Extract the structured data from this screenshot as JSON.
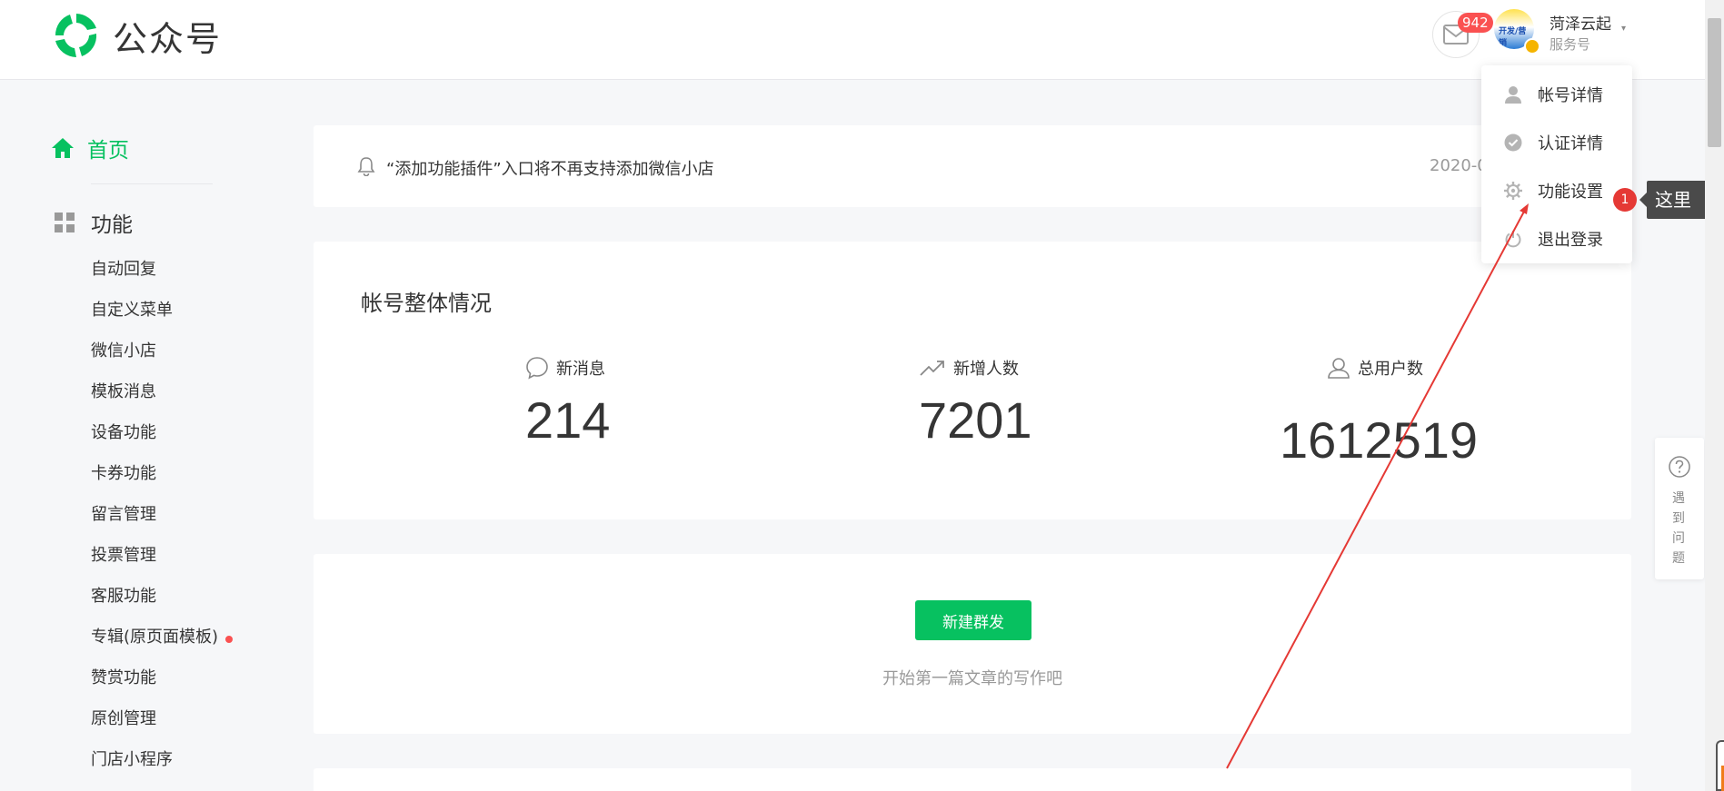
{
  "header": {
    "logo_text": "公众号",
    "message_count": "942",
    "account_name": "菏泽云起",
    "account_type": "服务号",
    "avatar_text": "开发/营销",
    "caret": "▾"
  },
  "sidebar": {
    "home_label": "首页",
    "function_label": "功能",
    "items": [
      {
        "label": "自动回复"
      },
      {
        "label": "自定义菜单"
      },
      {
        "label": "微信小店"
      },
      {
        "label": "模板消息"
      },
      {
        "label": "设备功能"
      },
      {
        "label": "卡券功能"
      },
      {
        "label": "留言管理"
      },
      {
        "label": "投票管理"
      },
      {
        "label": "客服功能"
      },
      {
        "label": "专辑(原页面模板)",
        "new_dot": true
      },
      {
        "label": "赞赏功能"
      },
      {
        "label": "原创管理"
      },
      {
        "label": "门店小程序"
      }
    ]
  },
  "notice": {
    "text": "“添加功能插件”入口将不再支持添加微信小店",
    "date": "2020-0"
  },
  "stats": {
    "title": "帐号整体情况",
    "items": [
      {
        "label": "新消息",
        "value": "214",
        "icon": "chat-bubble-icon"
      },
      {
        "label": "新增人数",
        "value": "7201",
        "icon": "trend-up-icon"
      },
      {
        "label": "总用户数",
        "value": "1612519",
        "icon": "user-icon"
      }
    ]
  },
  "compose": {
    "button_label": "新建群发",
    "hint": "开始第一篇文章的写作吧"
  },
  "menu": {
    "items": [
      {
        "label": "帐号详情",
        "icon": "person-icon"
      },
      {
        "label": "认证详情",
        "icon": "verified-check-icon"
      },
      {
        "label": "功能设置",
        "icon": "gear-icon"
      },
      {
        "label": "退出登录",
        "icon": "power-icon"
      }
    ]
  },
  "annotation": {
    "step_number": "1",
    "tip_text": "这里"
  },
  "help": {
    "text": "遇到问题"
  },
  "colors": {
    "brand_green": "#07c160",
    "badge_red": "#fa5151",
    "annotation_red": "#e53935"
  }
}
